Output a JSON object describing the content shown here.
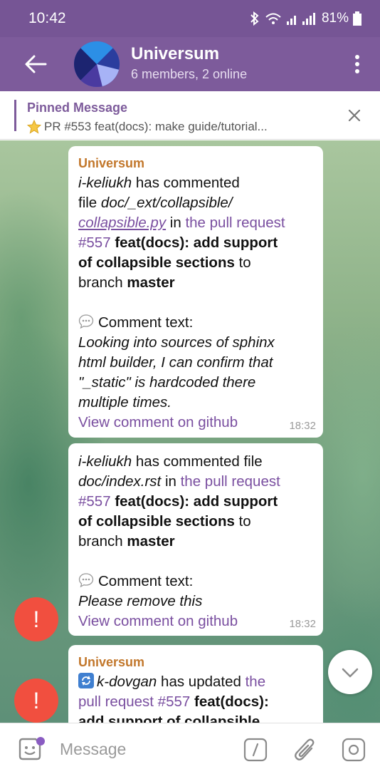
{
  "status_bar": {
    "time": "10:42",
    "battery": "81%"
  },
  "chat_header": {
    "title": "Universum",
    "subtitle": "6 members, 2 online"
  },
  "pinned": {
    "title": "Pinned Message",
    "text": "PR #553 feat(docs): make guide/tutorial..."
  },
  "messages": [
    {
      "sender": "Universum",
      "user": "i-keliukh",
      "has_commented_file": "has commented",
      "file_word": "file",
      "file_dir": "doc/_ext/collapsible/",
      "file_name": "collapsible.py",
      "in_the": "in",
      "pr_link": "the pull request",
      "pr_number": "#557",
      "pr_title": "feat(docs): add support of collapsible sections",
      "to": "to",
      "branch_word": "branch",
      "branch": "master",
      "comment_label": "Comment text:",
      "comment": "Looking into sources of sphinx html builder, I can confirm that \"_static\" is hardcoded there multiple times.",
      "view_link": "View comment on github",
      "time": "18:32"
    },
    {
      "user": "i-keliukh",
      "has_commented_file": "has commented file",
      "file": "doc/index.rst",
      "in_the": "in",
      "pr_link": "the pull request",
      "pr_number": "#557",
      "pr_title_1": "feat(docs): add support",
      "pr_title_2": "of collapsible sections",
      "to": "to",
      "branch_word": "branch",
      "branch": "master",
      "comment_label": "Comment text:",
      "comment": "Please remove this",
      "view_link": "View comment on github",
      "time": "18:32"
    },
    {
      "sender": "Universum",
      "user": "k-dovgan",
      "has_updated": "has updated",
      "pr_link_1": "the",
      "pr_link_2": "pull request #557",
      "pr_title_1": "feat(docs):",
      "pr_title_2": "add support of collapsible"
    }
  ],
  "alert_label": "!",
  "composer": {
    "placeholder": "Message"
  },
  "colors": {
    "header": "#7d5b9b",
    "statusbar": "#765595",
    "link": "#7a4fa0",
    "sender": "#c2772b",
    "alert": "#f14f3f"
  }
}
